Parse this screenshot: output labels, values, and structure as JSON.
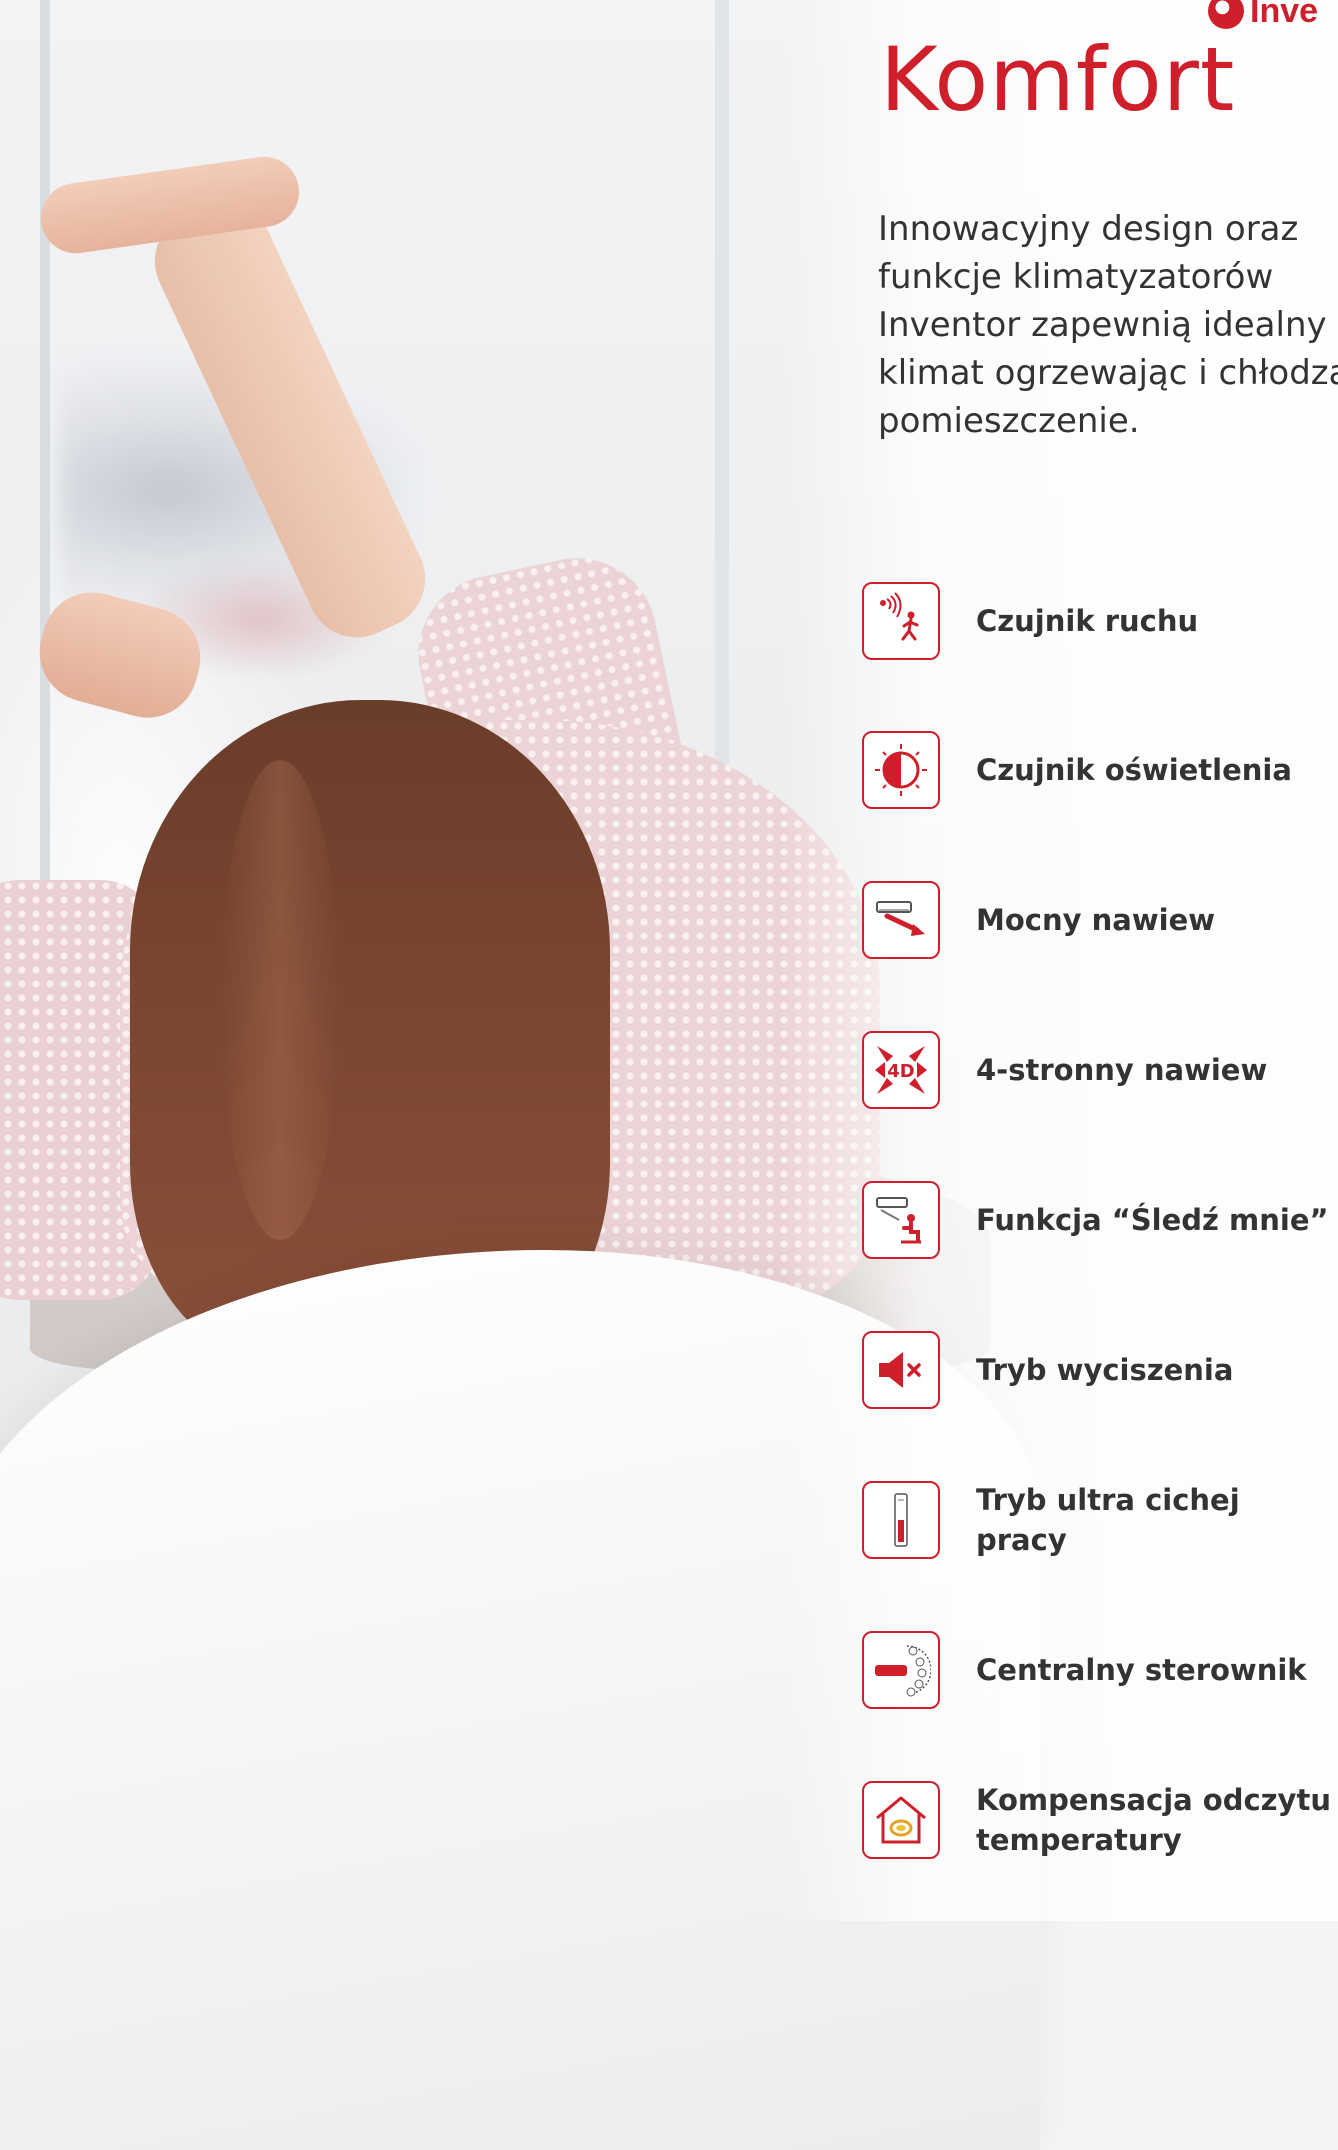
{
  "brand": {
    "logo_text": "Inve",
    "accent_color": "#cf1f2b"
  },
  "page": {
    "title": "Komfort",
    "intro": "Innowacyjny design oraz\nfunkcje klimatyzatorów\nInventor zapewnią idealny\nklimat ogrzewając i chłodząc\npomieszczenie."
  },
  "features": [
    {
      "label": "Czujnik ruchu",
      "icon": "motion-sensor-icon"
    },
    {
      "label": "Czujnik oświetlenia",
      "icon": "light-sensor-icon"
    },
    {
      "label": "Mocny nawiew",
      "icon": "strong-airflow-icon"
    },
    {
      "label": "4-stronny nawiew",
      "icon": "4d-airflow-icon"
    },
    {
      "label": "Funkcja “Śledź mnie”",
      "icon": "follow-me-icon"
    },
    {
      "label": "Tryb wyciszenia",
      "icon": "mute-icon"
    },
    {
      "label": "Tryb ultra cichej pracy",
      "icon": "ultra-quiet-icon"
    },
    {
      "label": "Centralny sterownik",
      "icon": "central-controller-icon"
    },
    {
      "label": "Kompensacja odczytu\ntemperatury",
      "icon": "temperature-compensation-icon"
    }
  ]
}
